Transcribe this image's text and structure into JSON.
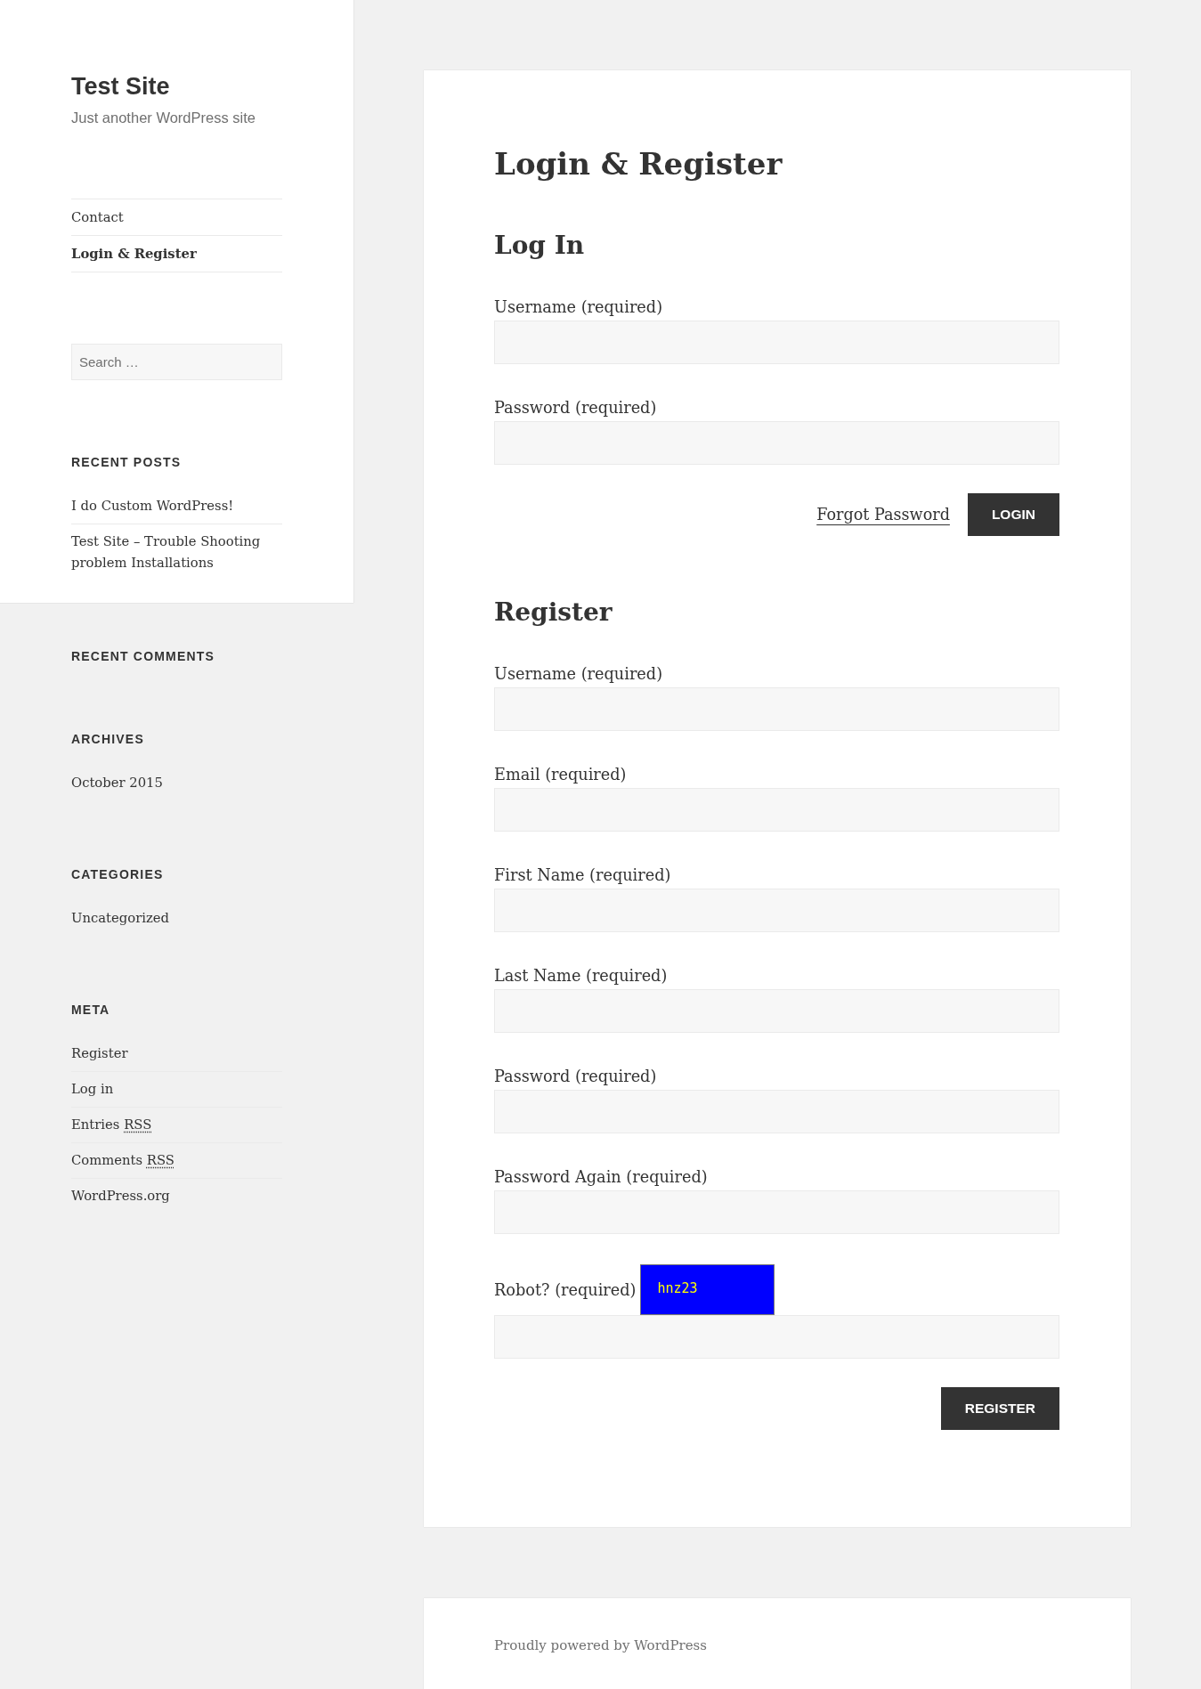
{
  "sidebar": {
    "title": "Test Site",
    "tagline": "Just another WordPress site",
    "nav": [
      {
        "label": "Contact",
        "selected": false
      },
      {
        "label": "Login & Register",
        "selected": true
      }
    ],
    "search": {
      "placeholder": "Search …"
    },
    "recent_posts": {
      "title": "RECENT POSTS",
      "items": [
        {
          "label": "I do Custom WordPress!"
        },
        {
          "label": "Test Site – Trouble Shooting problem Installations"
        }
      ]
    },
    "widgets": [
      {
        "title": "RECENT COMMENTS"
      },
      {
        "title": "ARCHIVES",
        "items": [
          {
            "label": "October 2015"
          }
        ]
      },
      {
        "title": "CATEGORIES",
        "items": [
          {
            "label": "Uncategorized"
          }
        ]
      },
      {
        "title": "META",
        "items": [
          {
            "label": "Register"
          },
          {
            "label": "Log in"
          },
          {
            "label": "Entries",
            "abbr": "RSS"
          },
          {
            "label": "Comments",
            "abbr": "RSS"
          },
          {
            "label": "WordPress.org"
          }
        ]
      }
    ]
  },
  "page": {
    "title": "Login & Register",
    "sections": [
      {
        "heading": "Log In",
        "fields": [
          {
            "label": "Username (required)"
          },
          {
            "label": "Password (required)"
          }
        ],
        "actions": [
          {
            "kind": "link",
            "label": "Forgot Password"
          },
          {
            "kind": "button",
            "label": "LOGIN"
          }
        ]
      },
      {
        "heading": "Register",
        "fields": [
          {
            "label": "Username (required)"
          },
          {
            "label": "Email (required)"
          },
          {
            "label": "First Name (required)"
          },
          {
            "label": "Last Name (required)"
          },
          {
            "label": "Password (required)"
          },
          {
            "label": "Password Again (required)"
          },
          {
            "label": "Robot? (required)",
            "captcha": "hnz23"
          }
        ],
        "actions": [
          {
            "kind": "button",
            "label": "REGISTER"
          }
        ]
      }
    ]
  },
  "footer": {
    "text": "Proudly powered by WordPress"
  }
}
